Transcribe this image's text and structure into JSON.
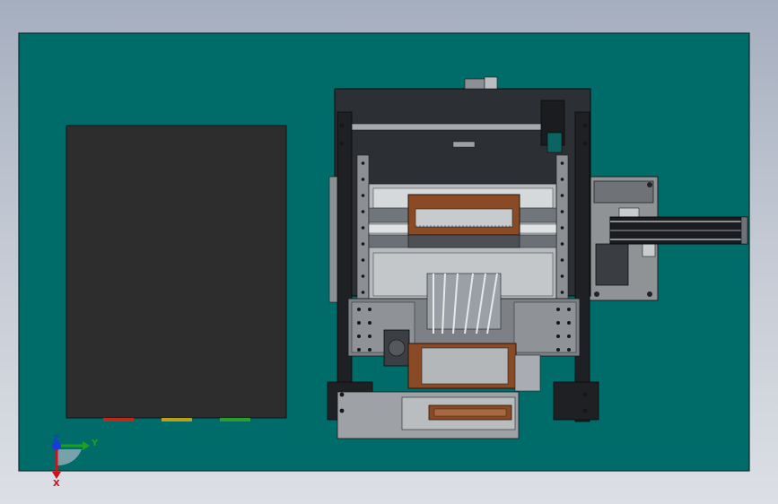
{
  "colors": {
    "background_top": "#a5aebf",
    "background_bottom": "#dcdfe5",
    "base_plate": "#006c6a",
    "cabinet": "#2d2d2d",
    "machine_frame": "#2c2f33",
    "steel_light": "#b9bdc0",
    "steel_mid": "#8c9095",
    "copper": "#8a4a26",
    "axis_x": "#d0101a",
    "axis_y": "#1ea01e",
    "axis_z": "#1a3adc"
  },
  "indicator_strips": [
    {
      "name": "red-strip",
      "color": "#c0281e"
    },
    {
      "name": "yellow-strip",
      "color": "#b8a01c"
    },
    {
      "name": "green-strip",
      "color": "#2e9c2e"
    }
  ],
  "axis_triad": {
    "x_label": "X",
    "y_label": "Y",
    "z_label": "Z"
  }
}
